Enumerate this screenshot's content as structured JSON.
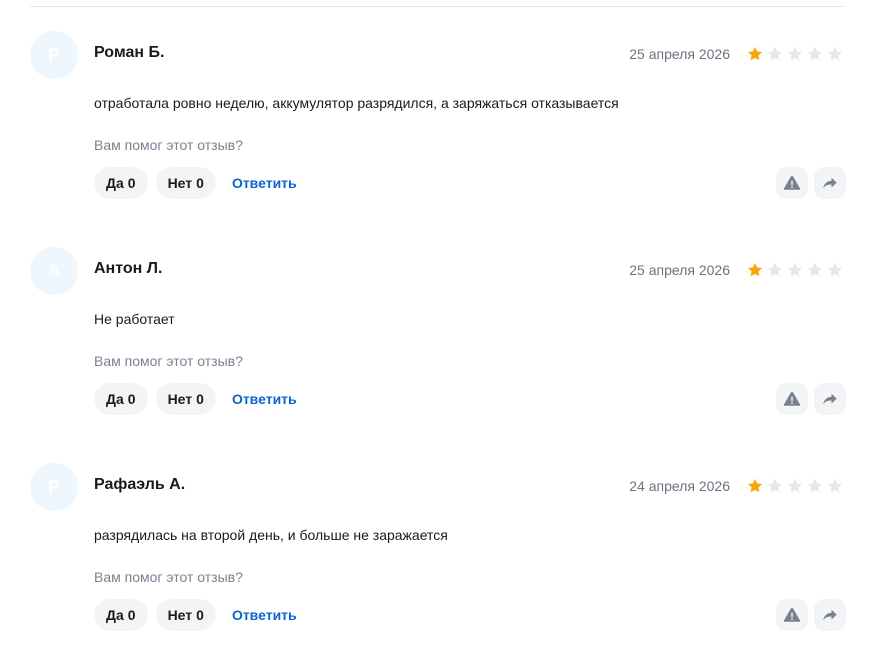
{
  "reviews": [
    {
      "initial": "Р",
      "author": "Роман Б.",
      "date": "25 апреля 2026",
      "rating": 1,
      "text": "отработала ровно неделю, аккумулятор разрядился, а заряжаться отказывается",
      "helpful_question": "Вам помог этот отзыв?",
      "yes_label": "Да",
      "yes_count": "0",
      "no_label": "Нет",
      "no_count": "0",
      "reply_label": "Ответить"
    },
    {
      "initial": "А",
      "author": "Антон Л.",
      "date": "25 апреля 2026",
      "rating": 1,
      "text": "Не работает",
      "helpful_question": "Вам помог этот отзыв?",
      "yes_label": "Да",
      "yes_count": "0",
      "no_label": "Нет",
      "no_count": "0",
      "reply_label": "Ответить"
    },
    {
      "initial": "Р",
      "author": "Рафаэль А.",
      "date": "24 апреля 2026",
      "rating": 1,
      "text": "разрядилась на второй день, и больше не заражается",
      "helpful_question": "Вам помог этот отзыв?",
      "yes_label": "Да",
      "yes_count": "0",
      "no_label": "Нет",
      "no_count": "0",
      "reply_label": "Ответить"
    }
  ],
  "max_rating": 5,
  "colors": {
    "star_filled": "#f6a609",
    "star_empty": "#e5e7eb",
    "link": "#0b63ce",
    "icon": "#7a8190"
  },
  "icons": {
    "report": "warning-icon",
    "share": "share-arrow-icon",
    "star": "star-icon"
  }
}
